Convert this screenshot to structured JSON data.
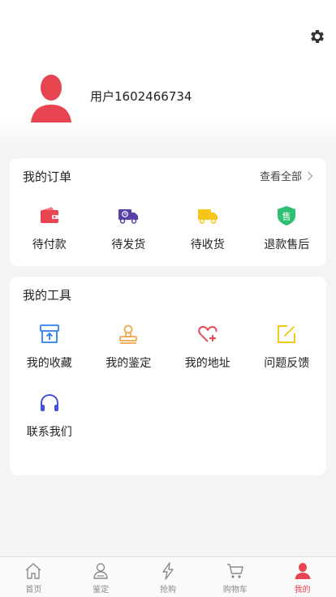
{
  "profile": {
    "username": "用户1602466734"
  },
  "orders": {
    "title": "我的订单",
    "view_all": "查看全部",
    "items": [
      {
        "label": "待付款",
        "icon": "wallet-icon"
      },
      {
        "label": "待发货",
        "icon": "delivery-truck-icon"
      },
      {
        "label": "待收货",
        "icon": "truck-icon"
      },
      {
        "label": "退款售后",
        "icon": "after-sales-shield-icon",
        "badge": "售"
      }
    ]
  },
  "tools": {
    "title": "我的工具",
    "items": [
      {
        "label": "我的收藏",
        "icon": "favorites-box-icon"
      },
      {
        "label": "我的鉴定",
        "icon": "appraisal-stamp-icon"
      },
      {
        "label": "我的地址",
        "icon": "heart-plus-icon"
      },
      {
        "label": "问题反馈",
        "icon": "edit-feedback-icon"
      },
      {
        "label": "联系我们",
        "icon": "headphones-icon"
      }
    ]
  },
  "tabbar": {
    "tabs": [
      {
        "label": "首页",
        "icon": "home-icon",
        "active": false
      },
      {
        "label": "鉴定",
        "icon": "appraise-user-icon",
        "active": false
      },
      {
        "label": "抢购",
        "icon": "lightning-icon",
        "active": false
      },
      {
        "label": "购物车",
        "icon": "cart-icon",
        "active": false
      },
      {
        "label": "我的",
        "icon": "profile-icon",
        "active": true
      }
    ]
  },
  "colors": {
    "accent": "#e84552",
    "purple": "#5b3fa8",
    "yellow": "#f5c518",
    "green": "#2fbf71",
    "blue": "#2d7ef5",
    "orange": "#f0a64a",
    "indigo": "#4452d8"
  }
}
